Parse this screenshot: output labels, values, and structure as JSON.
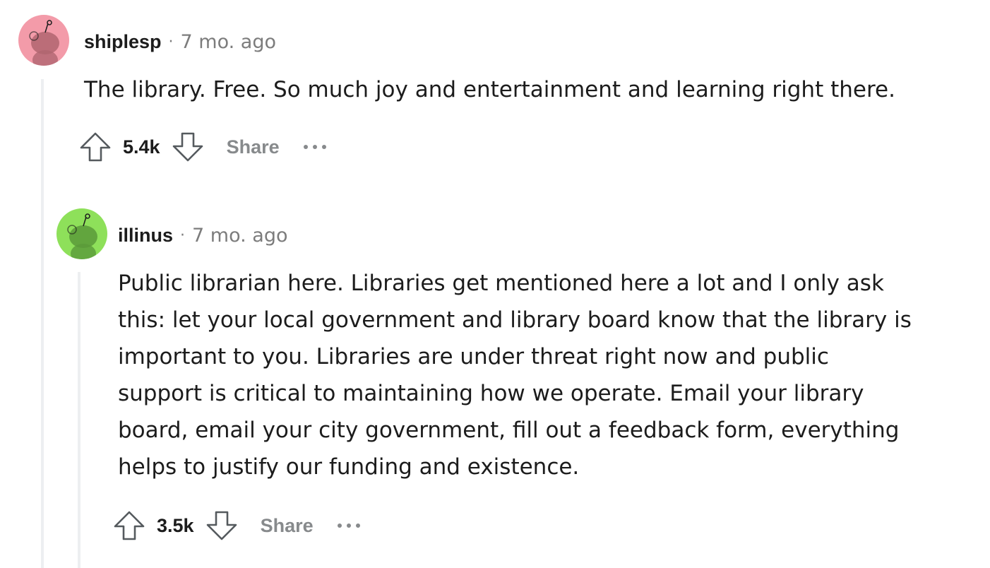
{
  "comments": [
    {
      "username": "shiplesp",
      "separator": "·",
      "time": "7 mo. ago",
      "body_lines": [
        "The library. Free. So much joy and entertainment and learning right there."
      ],
      "votes": "5.4k",
      "share_label": "Share",
      "avatar_color": "#f39ba9",
      "avatar_figure_color": "#b06570"
    },
    {
      "username": "illinus",
      "separator": "·",
      "time": "7 mo. ago",
      "body_lines": [
        "Public librarian here. Libraries get mentioned here a lot and I only ask",
        "this: let your local government and library board know that the library is",
        "important to you. Libraries are under threat right now and public",
        "support is critical to maintaining how we operate. Email your library",
        "board, email your city government, fill out a feedback form, everything",
        "helps to justify our funding and existence."
      ],
      "votes": "3.5k",
      "share_label": "Share",
      "avatar_color": "#8ee05a",
      "avatar_figure_color": "#5a9a3a"
    }
  ],
  "icons": {
    "upvote": "arrow-up-icon",
    "downvote": "arrow-down-icon",
    "more": "more-options-icon"
  }
}
